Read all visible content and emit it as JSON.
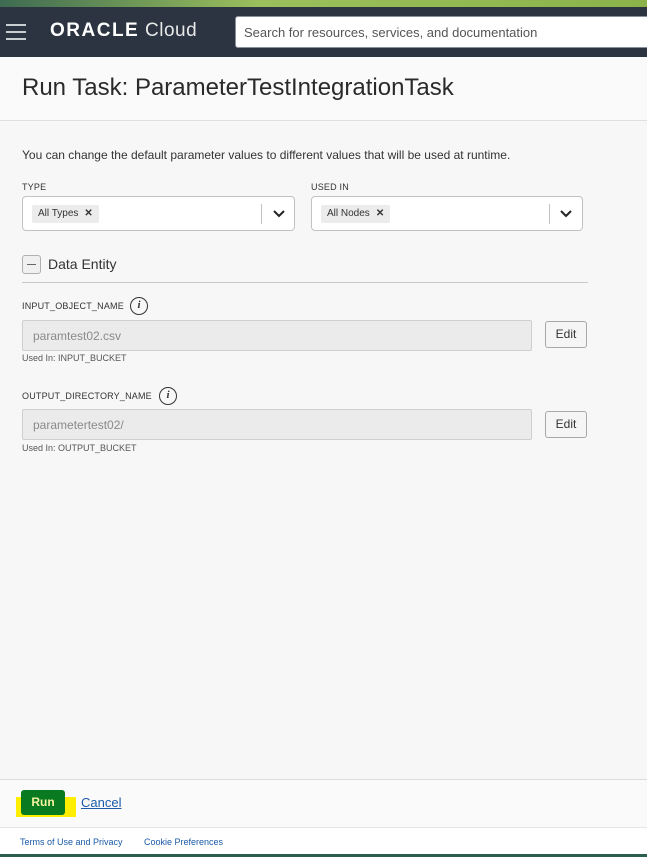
{
  "header": {
    "logo_brand": "ORACLE",
    "logo_product": "Cloud",
    "search_placeholder": "Search for resources, services, and documentation"
  },
  "page": {
    "title": "Run Task: ParameterTestIntegrationTask",
    "intro": "You can change the default parameter values to different values that will be used at runtime."
  },
  "filters": {
    "type": {
      "label": "TYPE",
      "chip": "All Types"
    },
    "used_in": {
      "label": "USED IN",
      "chip": "All Nodes"
    }
  },
  "section": {
    "title": "Data Entity"
  },
  "params": [
    {
      "name": "INPUT_OBJECT_NAME",
      "value": "paramtest02.csv",
      "used_in": "Used In: INPUT_BUCKET",
      "edit_label": "Edit"
    },
    {
      "name": "OUTPUT_DIRECTORY_NAME",
      "value": "parametertest02/",
      "used_in": "Used In: OUTPUT_BUCKET",
      "edit_label": "Edit"
    }
  ],
  "footer": {
    "run_label": "Run",
    "cancel_label": "Cancel",
    "links": [
      "Terms of Use and Privacy",
      "Cookie Preferences"
    ]
  },
  "colors": {
    "header_bg": "#2b3440",
    "run_button": "#0a7a20",
    "highlight": "#ffee00",
    "link": "#1a5aa6"
  }
}
